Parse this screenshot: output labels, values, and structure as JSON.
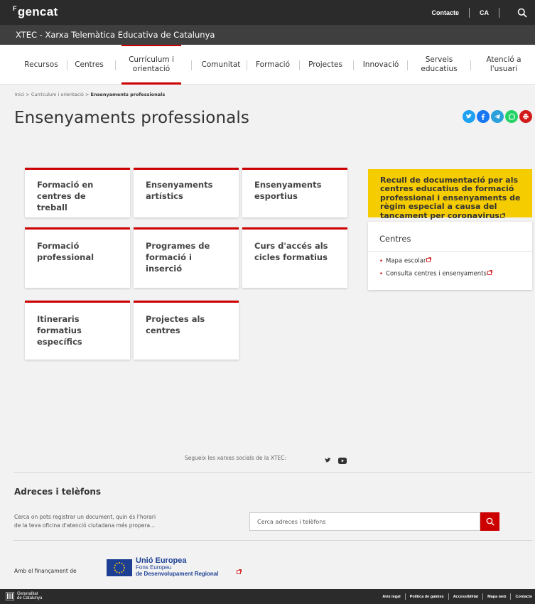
{
  "header": {
    "logo_mark": "F",
    "logo": "gencat",
    "contact": "Contacte",
    "lang": "CA"
  },
  "site": {
    "title": "XTEC - Xarxa Telemàtica Educativa de Catalunya"
  },
  "nav": {
    "items": [
      {
        "line1": "Recursos",
        "line2": ""
      },
      {
        "line1": "Centres",
        "line2": ""
      },
      {
        "line1": "Currículum i",
        "line2": "orientació"
      },
      {
        "line1": "Comunitat",
        "line2": ""
      },
      {
        "line1": "Formació",
        "line2": ""
      },
      {
        "line1": "Projectes",
        "line2": ""
      },
      {
        "line1": "Innovació",
        "line2": ""
      },
      {
        "line1": "Serveis",
        "line2": "educatius"
      },
      {
        "line1": "Atenció a",
        "line2": "l'usuari"
      }
    ],
    "active_index": 2
  },
  "breadcrumb": {
    "items": [
      "Inici",
      "Currículum i orientació",
      "Ensenyaments professionals"
    ],
    "separator": ">"
  },
  "page": {
    "title": "Ensenyaments professionals"
  },
  "share": {
    "icons": [
      {
        "name": "twitter-icon",
        "color": "#1da1f2"
      },
      {
        "name": "facebook-icon",
        "color": "#1877f2"
      },
      {
        "name": "telegram-icon",
        "color": "#2aa1da"
      },
      {
        "name": "whatsapp-icon",
        "color": "#25d366"
      },
      {
        "name": "print-icon",
        "color": "#d21a1a"
      }
    ]
  },
  "cards": [
    {
      "line1": "Formació en",
      "line2": "centres de treball",
      "line3": ""
    },
    {
      "line1": "Ensenyaments",
      "line2": "artístics",
      "line3": ""
    },
    {
      "line1": "Ensenyaments",
      "line2": "esportius",
      "line3": ""
    },
    {
      "line1": "Formació",
      "line2": "professional",
      "line3": ""
    },
    {
      "line1": "Programes de",
      "line2": "formació i",
      "line3": "inserció"
    },
    {
      "line1": "Curs d'accés als",
      "line2": "cicles formatius",
      "line3": ""
    },
    {
      "line1": "Itineraris",
      "line2": "formatius",
      "line3": "específics"
    },
    {
      "line1": "Projectes als",
      "line2": "centres",
      "line3": ""
    }
  ],
  "notice": {
    "line1": "Recull de documentació per als",
    "line2": "centres educatius de formació",
    "line3": "professional i ensenyaments de",
    "line4": "règim especial a causa del",
    "line5": "tancament per coronavirus"
  },
  "sidebar": {
    "title": "Centres",
    "links": [
      "Mapa escolar",
      "Consulta centres i ensenyaments"
    ]
  },
  "footer": {
    "follow_text": "Segueix les xarxes socials de la XTEC:",
    "addr_title": "Adreces i telèfons",
    "addr_desc_line1": "Cerca on pots registrar un document, quin és l'horari",
    "addr_desc_line2": "de la teva oficina d'atenció ciutadana més propera...",
    "search_placeholder": "Cerca adreces i telèfons",
    "funding": "Amb el finançament de",
    "eu_line1": "Unió Europea",
    "eu_line2": "Fons Europeu",
    "eu_line3": "de Desenvolupament Regional"
  },
  "bottom": {
    "gen_line1": "Generalitat",
    "gen_line2": "de Catalunya",
    "links": [
      "Avís legal",
      "Política de galetes",
      "Accessibilitat",
      "Mapa web",
      "Contacte"
    ]
  },
  "colors": {
    "accent_red": "#cc0000",
    "notice_yellow": "#f5cc00",
    "dark_bar": "#2b2b2b"
  }
}
